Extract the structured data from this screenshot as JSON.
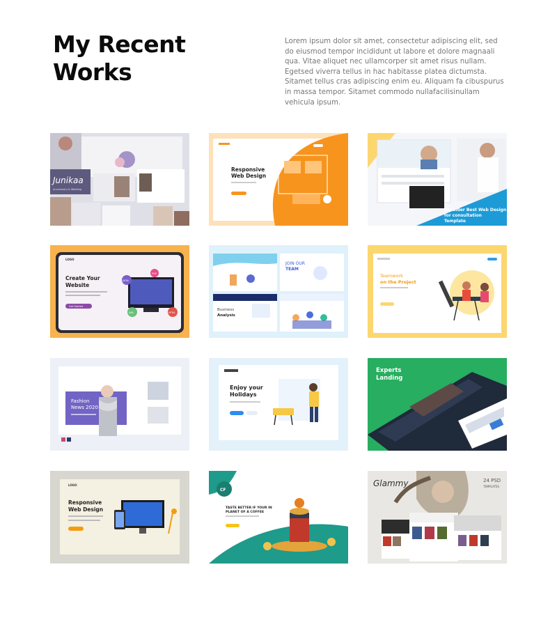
{
  "header": {
    "title_line1": "My Recent",
    "title_line2": "Works",
    "description": "Lorem ipsum dolor sit amet, consectetur adipiscing elit, sed do eiusmod tempor incididunt ut labore et dolore magnaali qua. Vitae aliquet nec ullamcorper sit amet risus nullam. Egetsed viverra tellus in hac habitasse platea dictumsta. Sitamet tellus cras adipiscing enim eu. Aliquam fa cibuspurus in massa tempor. Sitamet commodo nullafacilisinullam vehicula ipsum."
  },
  "works": [
    {
      "id": "wedding",
      "text": {
        "name": "Junikaa",
        "sub": "Anniversary & Wedding"
      }
    },
    {
      "id": "responsive-orange",
      "text": {
        "heading1": "Responsive",
        "heading2": "Web Design"
      }
    },
    {
      "id": "consultation",
      "text": {
        "line1": "Consider Best Web Design",
        "line2": "for consultation",
        "line3": "Template"
      }
    },
    {
      "id": "create-website",
      "text": {
        "logo": "LOGO",
        "heading1": "Create Your",
        "heading2": "Website",
        "button": "Get Started",
        "b1": "JSON",
        "b2": "PHP",
        "b3": "XML",
        "b4": "HTML"
      }
    },
    {
      "id": "team-business",
      "text": {
        "join": "JOIN OUR",
        "team": "TEAM",
        "business": "Business",
        "analysis": "Analysis"
      }
    },
    {
      "id": "teamwork",
      "text": {
        "heading1": "Teamwork",
        "heading2": "on the Project"
      }
    },
    {
      "id": "fashion",
      "text": {
        "heading1": "Fashion",
        "heading2": "News 2020"
      }
    },
    {
      "id": "holidays",
      "text": {
        "heading1": "Enjoy your",
        "heading2": "Holidays"
      }
    },
    {
      "id": "experts",
      "text": {
        "heading1": "Experts",
        "heading2": "Landing"
      }
    },
    {
      "id": "responsive-desk",
      "text": {
        "logo": "LOGO",
        "heading1": "Responsive",
        "heading2": "Web Design"
      }
    },
    {
      "id": "coffee",
      "text": {
        "logo": "CF",
        "line1": "TASTE BETTER IF YOUR IN",
        "line2": "PLANET OF A COFFEE"
      }
    },
    {
      "id": "glammy",
      "text": {
        "brand": "Glammy",
        "psd": "24 PSD",
        "tpl": "TEMPLATES"
      }
    }
  ],
  "colors": {
    "title": "#0b0b0b",
    "text": "#777777",
    "orange": "#f7941d",
    "green": "#27ae60",
    "yellow": "#fcd770",
    "purple": "#6f61c0"
  }
}
